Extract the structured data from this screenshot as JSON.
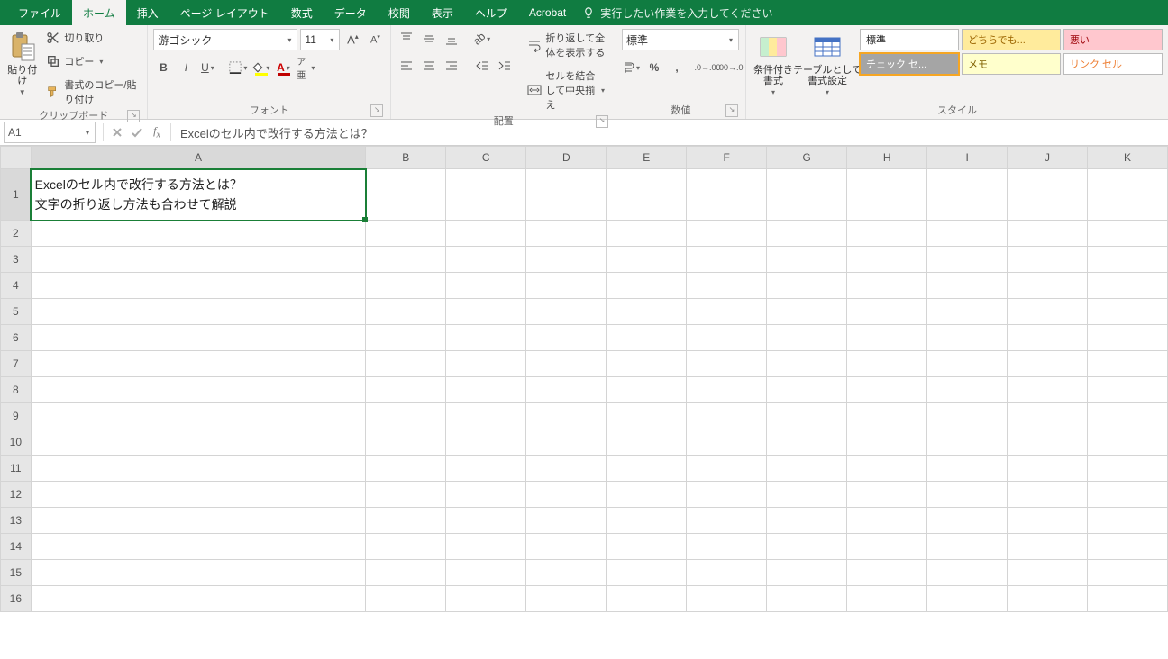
{
  "menubar": {
    "tabs": [
      "ファイル",
      "ホーム",
      "挿入",
      "ページ レイアウト",
      "数式",
      "データ",
      "校閲",
      "表示",
      "ヘルプ",
      "Acrobat"
    ],
    "active_index": 1,
    "tell_me": "実行したい作業を入力してください"
  },
  "ribbon": {
    "clipboard": {
      "paste": "貼り付け",
      "cut": "切り取り",
      "copy": "コピー",
      "format_painter": "書式のコピー/貼り付け",
      "label": "クリップボード"
    },
    "font": {
      "name": "游ゴシック",
      "size": "11",
      "label": "フォント"
    },
    "alignment": {
      "wrap": "折り返して全体を表示する",
      "merge": "セルを結合して中央揃え",
      "label": "配置"
    },
    "number": {
      "format": "標準",
      "label": "数値"
    },
    "styles": {
      "cond": "条件付き\n書式",
      "table": "テーブルとして\n書式設定",
      "gallery": [
        {
          "text": "標準",
          "bg": "#ffffff",
          "fg": "#222"
        },
        {
          "text": "どちらでも...",
          "bg": "#ffeb9c",
          "fg": "#9c6500"
        },
        {
          "text": "悪い",
          "bg": "#ffc7ce",
          "fg": "#9c0006"
        },
        {
          "text": "チェック セ...",
          "bg": "#a5a5a5",
          "fg": "#ffffff"
        },
        {
          "text": "メモ",
          "bg": "#ffffcc",
          "fg": "#806000"
        },
        {
          "text": "リンク セル",
          "bg": "#ffffff",
          "fg": "#ed7d31"
        }
      ],
      "label": "スタイル"
    }
  },
  "formula_bar": {
    "name_box": "A1",
    "formula": "Excelのセル内で改行する方法とは？"
  },
  "grid": {
    "columns": [
      "A",
      "B",
      "C",
      "D",
      "E",
      "F",
      "G",
      "H",
      "I",
      "J",
      "K"
    ],
    "rows": 16,
    "active_cell": "A1",
    "cells": {
      "A1": "Excelのセル内で改行する方法とは？\n文字の折り返し方法も合わせて解説"
    }
  }
}
